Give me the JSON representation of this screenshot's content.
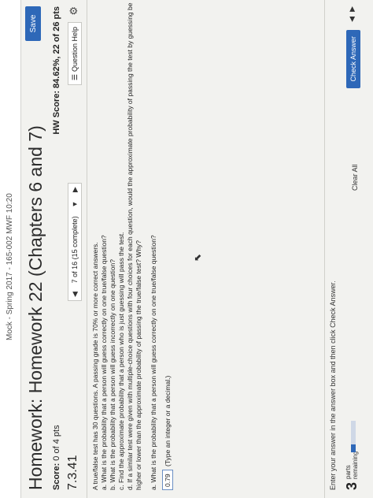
{
  "header": {
    "course": "Mock - Spring 2017 - 165-002 MWF 10:20"
  },
  "assignment": {
    "title": "Homework: Homework 22 (Chapters 6 and 7)",
    "save_label": "Save",
    "score_label": "Score:",
    "score_value": "0 of 4 pts",
    "hw_score_label": "HW Score:",
    "hw_score_value": "84.62%, 22 of 26 pts",
    "question_number": "7.3.41",
    "nav_text": "7 of 16 (15 complete)",
    "help_label": "Question Help"
  },
  "question": {
    "lines": [
      "A true/false test has 30 questions. A passing grade is 70% or more correct answers.",
      "a. What is the probability that a person will guess correctly on one true/false question?",
      "b. What is the probability that a person will guess incorrectly on one question?",
      "c. Find the approximate probability that a person who is just guessing will pass the test.",
      "d. If a similar test were given with multiple-choice questions with four choices for each question, would the approximate probability of passing the test by guessing be",
      "higher or lower than the approximate probability of passing the true/false test? Why?"
    ],
    "sub_question": "a. What is the probability that a person will guess correctly on one true/false question?",
    "answer": "0.79",
    "answer_hint": "(Type an integer or a decimal.)"
  },
  "footer": {
    "instructions": "Enter your answer in the answer box and then click Check Answer.",
    "parts_count": "3",
    "parts_label_1": "parts",
    "parts_label_2": "remaining",
    "progress_fraction": 0.25,
    "clear_all": "Clear All",
    "check_answer": "Check Answer"
  }
}
